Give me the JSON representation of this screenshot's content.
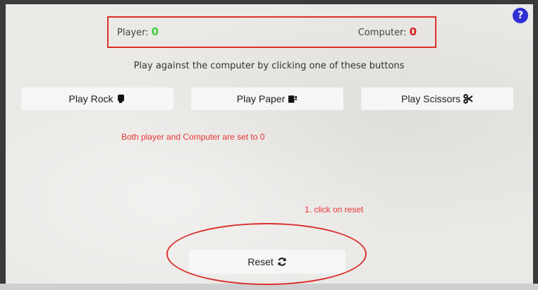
{
  "help": {
    "label": "?"
  },
  "score": {
    "player_label": "Player:",
    "player_value": "0",
    "computer_label": "Computer:",
    "computer_value": "0"
  },
  "instructions": "Play against the computer by clicking one of these buttons",
  "buttons": {
    "rock": "Play Rock",
    "paper": "Play Paper",
    "scissors": "Play Scissors",
    "reset": "Reset"
  },
  "icons": {
    "rock": "hand-rock-icon",
    "paper": "hand-paper-icon",
    "scissors": "scissors-icon",
    "reset": "sync-icon"
  },
  "status_message": "Both player and Computer are set to 0",
  "annotation": "1. click on reset",
  "colors": {
    "player_score": "#3ecf3e",
    "computer_score": "#d91f1f",
    "annotation_red": "#d9302d",
    "help_blue": "#2f2fd6"
  }
}
